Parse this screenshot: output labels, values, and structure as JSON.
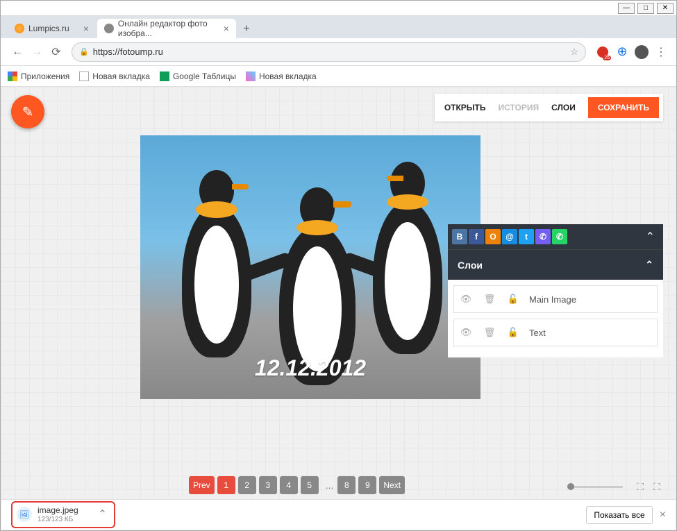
{
  "window": {
    "min": "—",
    "max": "□",
    "close": "✕"
  },
  "tabs": {
    "tab1": "Lumpics.ru",
    "tab2": "Онлайн редактор фото изобра..."
  },
  "addr": {
    "url": "https://fotoump.ru",
    "badge": "26"
  },
  "bookmarks": {
    "apps": "Приложения",
    "new1": "Новая вкладка",
    "sheets": "Google Таблицы",
    "new2": "Новая вкладка"
  },
  "toolbar": {
    "open": "ОТКРЫТЬ",
    "history": "ИСТОРИЯ",
    "layers": "СЛОИ",
    "save": "СОХРАНИТЬ"
  },
  "image": {
    "watermark": "12.12.2012"
  },
  "pager": {
    "prev": "Prev",
    "p1": "1",
    "p2": "2",
    "p3": "3",
    "p4": "4",
    "p5": "5",
    "p8": "8",
    "p9": "9",
    "next": "Next"
  },
  "panel": {
    "layers_title": "Слои",
    "layer1": "Main Image",
    "layer2": "Text"
  },
  "share": {
    "vk": "VK",
    "fb": "f",
    "ok": "OK",
    "mm": "@",
    "tw": "t",
    "vb": "V",
    "wa": "W"
  },
  "download": {
    "filename": "image.jpeg",
    "size": "123/123 КБ",
    "show_all": "Показать все"
  }
}
